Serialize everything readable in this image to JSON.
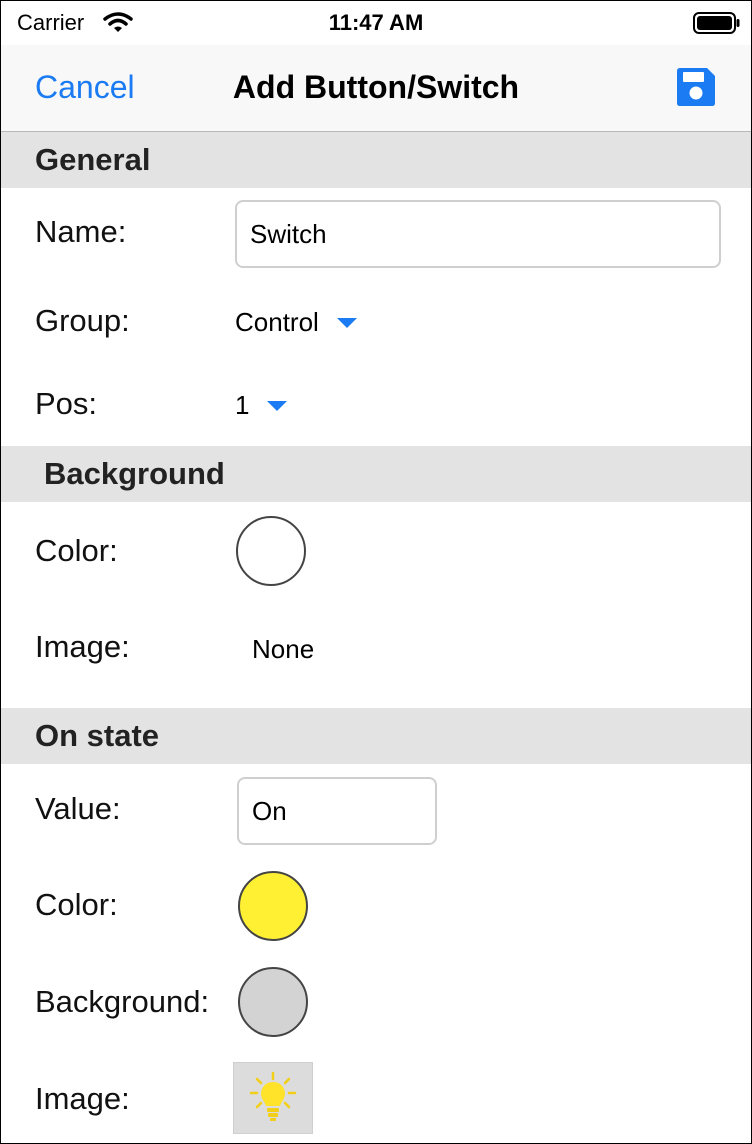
{
  "status_bar": {
    "carrier": "Carrier",
    "time": "11:47 AM",
    "icons": [
      "wifi-icon",
      "battery-icon"
    ]
  },
  "nav": {
    "cancel_label": "Cancel",
    "title": "Add Button/Switch",
    "save_icon": "floppy-disk-icon",
    "accent_color": "#1a7bf2"
  },
  "general": {
    "header": "General",
    "name_label": "Name:",
    "name_value": "Switch",
    "group_label": "Group:",
    "group_value": "Control",
    "pos_label": "Pos:",
    "pos_value": "1"
  },
  "background": {
    "header": "Background",
    "color_label": "Color:",
    "color_value": "#ffffff",
    "image_label": "Image:",
    "image_value": "None"
  },
  "on_state": {
    "header": "On state",
    "value_label": "Value:",
    "value_value": "On",
    "color_label": "Color:",
    "color_value": "#fff033",
    "background_label": "Background:",
    "background_value": "#d3d3d3",
    "image_label": "Image:",
    "image_icon": "lightbulb-icon"
  }
}
